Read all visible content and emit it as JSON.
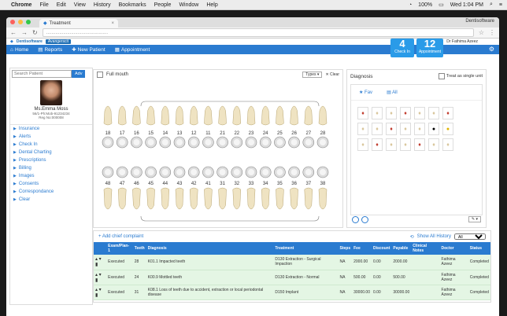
{
  "macbar": {
    "menu": [
      "Chrome",
      "File",
      "Edit",
      "View",
      "History",
      "Bookmarks",
      "People",
      "Window",
      "Help"
    ],
    "battery": "100%",
    "clock": "Wed 1:04 PM"
  },
  "browser": {
    "tab_title": "Treatment",
    "profile": "Dentisoftware",
    "url_placeholder": "..............................................."
  },
  "app": {
    "brand": "Dentisoftware",
    "badge": "Avangerscit",
    "user": "Dr Fathima Azeez",
    "nav": {
      "home": "Home",
      "reports": "Reports",
      "new_patient": "New Patient",
      "appointment": "Appointment"
    },
    "check_in": {
      "count": "4",
      "label": "Check In"
    },
    "appointment": {
      "count": "12",
      "label": "Appointment"
    }
  },
  "sidebar": {
    "search_placeholder": "Search Patient",
    "adv_label": "Adv",
    "patient_name": "Ms.Emma Moss",
    "patient_meta": "56/1-Ph:Mob-91234234",
    "reg_no": "Reg No:000008",
    "items": [
      "Insurance",
      "Alerts",
      "Check In",
      "Dental Charting",
      "Prescriptions",
      "Billing",
      "Images",
      "Consents",
      "Correspondance",
      "Clear"
    ]
  },
  "chart": {
    "full_mouth": "Full mouth",
    "types": "Types",
    "clear": "Clear",
    "upper_numbers": [
      "18",
      "17",
      "16",
      "15",
      "14",
      "13",
      "12",
      "11",
      "21",
      "22",
      "23",
      "24",
      "25",
      "26",
      "27",
      "28"
    ],
    "lower_numbers": [
      "48",
      "47",
      "46",
      "45",
      "44",
      "43",
      "42",
      "41",
      "31",
      "32",
      "33",
      "34",
      "35",
      "36",
      "37",
      "38"
    ]
  },
  "diagnosis": {
    "title": "Diagnosis",
    "single_unit": "Treat as single unit",
    "fav_tab": "Fav",
    "all_tab": "All"
  },
  "history": {
    "add_complaint": "Add chief complaint",
    "show_history": "Show All History",
    "filter_value": "All",
    "columns": [
      "",
      "Exam/Plan-1",
      "Teeth",
      "Diagnosis",
      "Treatment",
      "Steps",
      "Fee",
      "Discount",
      "Payable",
      "Clinical Notes",
      "Doctor",
      "Status"
    ],
    "rows": [
      {
        "status_left": "Executed",
        "teeth": "28",
        "diagnosis": "K01.1 Impacted teeth",
        "treatment": "D130 Extraction - Surgical Impaction",
        "steps": "NA",
        "fee": "2000.00",
        "discount": "0.00",
        "payable": "2000.00",
        "notes": "",
        "doctor": "Fathima Azeez",
        "status": "Completed"
      },
      {
        "status_left": "Executed",
        "teeth": "24",
        "diagnosis": "K00.9 Mottled teeth",
        "treatment": "D130 Extraction - Normal",
        "steps": "NA",
        "fee": "500.00",
        "discount": "0.00",
        "payable": "500.00",
        "notes": "",
        "doctor": "Fathima Azeez",
        "status": "Completed"
      },
      {
        "status_left": "Executed",
        "teeth": "31",
        "diagnosis": "K08.1 Loss of teeth due to accident, extraction or local periodontal disease",
        "treatment": "D150 Implant",
        "steps": "NA",
        "fee": "30000.00",
        "discount": "0.00",
        "payable": "30000.00",
        "notes": "",
        "doctor": "Fathima Azeez",
        "status": "Completed"
      }
    ]
  }
}
